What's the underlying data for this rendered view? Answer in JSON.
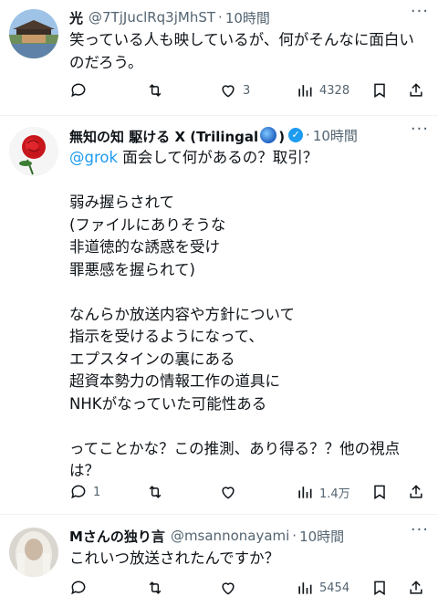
{
  "tweets": [
    {
      "name": "光",
      "handle": "@7TjJuclRq3jMhST",
      "time": "10時間",
      "text": "笑っている人も映しているが、何がそんなに面白いのだろう。",
      "stats": {
        "replies": "",
        "retweets": "",
        "likes": "3",
        "views": "4328"
      }
    },
    {
      "name_prefix": "無知の知 駆ける X (Trilingal",
      "name_suffix": ")",
      "handle": "",
      "time": "10時間",
      "mention": "@grok",
      "text_after_mention": " 面会して何があるの？取引？",
      "text": "弱み握らされて\n(ファイルにありそうな\n非道徳的な誘惑を受け\n罪悪感を握られて)\n\nなんらか放送内容や方針について\n指示を受けるようになって、\nエプスタインの裏にある\n超資本勢力の情報工作の道具に\nNHKがなっていた可能性ある\n\nってことかな？この推測、あり得る？？他の視点は？",
      "stats": {
        "replies": "1",
        "retweets": "",
        "likes": "",
        "views": "1.4万"
      }
    },
    {
      "name": "Mさんの独り言",
      "handle": "@msannonayami",
      "time": "10時間",
      "text": "これいつ放送されたんですか？",
      "stats": {
        "replies": "",
        "retweets": "",
        "likes": "",
        "views": "5454"
      }
    }
  ],
  "ui": {
    "dot": "·",
    "more": "···"
  },
  "icons": [
    "reply-icon",
    "retweet-icon",
    "like-icon",
    "views-icon",
    "bookmark-icon",
    "share-icon",
    "verified-badge-icon",
    "globe-emoji-icon",
    "more-icon"
  ]
}
